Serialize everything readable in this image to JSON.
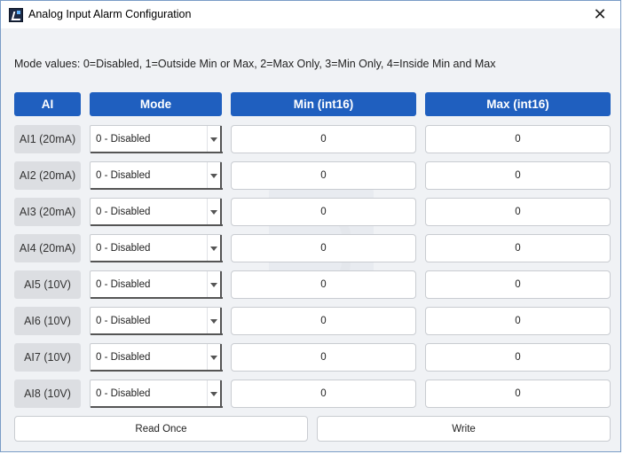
{
  "window": {
    "title": "Analog Input Alarm Configuration",
    "close_glyph": "✕"
  },
  "note": "Mode values: 0=Disabled, 1=Outside Min or Max, 2=Max Only, 3=Min Only, 4=Inside Min and Max",
  "headers": {
    "ai": "AI",
    "mode": "Mode",
    "min": "Min (int16)",
    "max": "Max (int16)"
  },
  "rows": [
    {
      "label": "AI1 (20mA)",
      "mode": "0 - Disabled",
      "min": "0",
      "max": "0"
    },
    {
      "label": "AI2 (20mA)",
      "mode": "0 - Disabled",
      "min": "0",
      "max": "0"
    },
    {
      "label": "AI3 (20mA)",
      "mode": "0 - Disabled",
      "min": "0",
      "max": "0"
    },
    {
      "label": "AI4 (20mA)",
      "mode": "0 - Disabled",
      "min": "0",
      "max": "0"
    },
    {
      "label": "AI5 (10V)",
      "mode": "0 - Disabled",
      "min": "0",
      "max": "0"
    },
    {
      "label": "AI6 (10V)",
      "mode": "0 - Disabled",
      "min": "0",
      "max": "0"
    },
    {
      "label": "AI7 (10V)",
      "mode": "0 - Disabled",
      "min": "0",
      "max": "0"
    },
    {
      "label": "AI8 (10V)",
      "mode": "0 - Disabled",
      "min": "0",
      "max": "0"
    }
  ],
  "buttons": {
    "read_once": "Read Once",
    "write": "Write"
  },
  "colors": {
    "header_bg": "#1f5fbf",
    "label_bg": "#dcdee2",
    "window_bg": "#f0f2f5"
  }
}
